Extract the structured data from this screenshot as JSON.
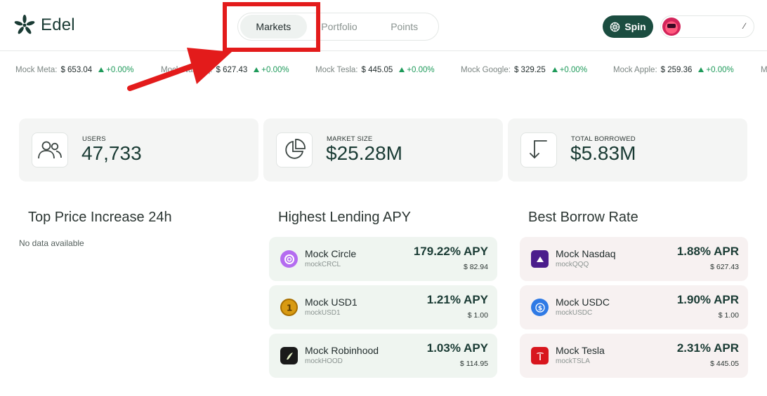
{
  "brand": {
    "name": "Edel",
    "accent": "#1b4d40"
  },
  "nav": {
    "tabs": [
      {
        "label": "Markets",
        "active": true
      },
      {
        "label": "Portfolio",
        "active": false
      },
      {
        "label": "Points",
        "active": false
      }
    ]
  },
  "header": {
    "spin_label": "Spin",
    "spin_icon": "spin-wheel-icon",
    "account_icon": "edit-icon"
  },
  "ticker": [
    {
      "name": "Mock Meta:",
      "price": "$ 653.04",
      "change": "+0.00%"
    },
    {
      "name": "Mock Nasdaq:",
      "price": "$ 627.43",
      "change": "+0.00%"
    },
    {
      "name": "Mock Tesla:",
      "price": "$ 445.05",
      "change": "+0.00%"
    },
    {
      "name": "Mock Google:",
      "price": "$ 329.25",
      "change": "+0.00%"
    },
    {
      "name": "Mock Apple:",
      "price": "$ 259.36",
      "change": "+0.00%"
    },
    {
      "name": "M",
      "price": "",
      "change": ""
    }
  ],
  "stats": [
    {
      "label": "USERS",
      "value": "47,733",
      "icon": "users-icon"
    },
    {
      "label": "MARKET SIZE",
      "value": "$25.28M",
      "icon": "pie-chart-icon"
    },
    {
      "label": "TOTAL BORROWED",
      "value": "$5.83M",
      "icon": "arrow-down-icon"
    }
  ],
  "sections": {
    "top_price": {
      "title": "Top Price Increase 24h",
      "empty": "No data available"
    },
    "lending": {
      "title": "Highest Lending APY",
      "items": [
        {
          "name": "Mock Circle",
          "symbol": "mockCRCL",
          "rate": "179.22% APY",
          "price": "$ 82.94",
          "icon": "circle-logo-icon"
        },
        {
          "name": "Mock USD1",
          "symbol": "mockUSD1",
          "rate": "1.21% APY",
          "price": "$ 1.00",
          "icon": "usd1-logo-icon"
        },
        {
          "name": "Mock Robinhood",
          "symbol": "mockHOOD",
          "rate": "1.03% APY",
          "price": "$ 114.95",
          "icon": "robinhood-logo-icon"
        }
      ]
    },
    "borrow": {
      "title": "Best Borrow Rate",
      "items": [
        {
          "name": "Mock Nasdaq",
          "symbol": "mockQQQ",
          "rate": "1.88% APR",
          "price": "$ 627.43",
          "icon": "nasdaq-logo-icon"
        },
        {
          "name": "Mock USDC",
          "symbol": "mockUSDC",
          "rate": "1.90% APR",
          "price": "$ 1.00",
          "icon": "usdc-logo-icon"
        },
        {
          "name": "Mock Tesla",
          "symbol": "mockTSLA",
          "rate": "2.31% APR",
          "price": "$ 445.05",
          "icon": "tesla-logo-icon"
        }
      ]
    }
  },
  "annotation": {
    "color": "#e31b1b"
  }
}
